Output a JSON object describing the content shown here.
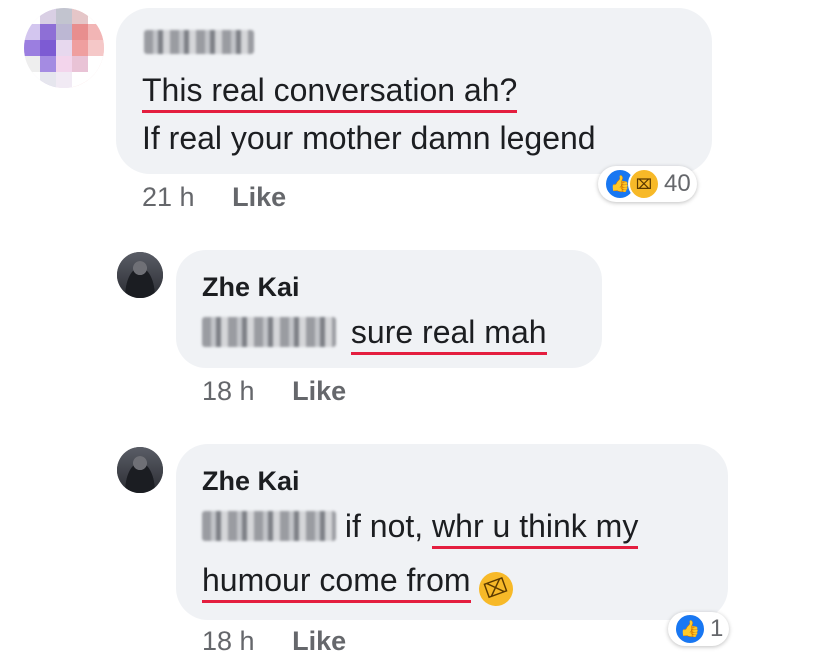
{
  "comments": [
    {
      "author": "",
      "lines": [
        "This real conversation ah?",
        "If real your mother damn legend"
      ],
      "time": "21 h",
      "like_label": "Like",
      "reactions": {
        "icons": [
          "like-icon",
          "haha-icon"
        ],
        "count": "40"
      }
    }
  ],
  "replies": [
    {
      "author": "Zhe Kai",
      "text": "sure real mah",
      "time": "18 h",
      "like_label": "Like"
    },
    {
      "author": "Zhe Kai",
      "text_a": "if not,",
      "text_b": "whr u think my",
      "text_c": "humour come from",
      "emoji": "rolling-on-floor-laughing-emoji",
      "time": "18 h",
      "like_label": "Like",
      "reactions": {
        "icons": [
          "like-icon"
        ],
        "count": "1"
      }
    }
  ],
  "colors": {
    "underline": "#e41e3f",
    "bubble": "#f0f2f5",
    "like_blue": "#1877f2"
  }
}
